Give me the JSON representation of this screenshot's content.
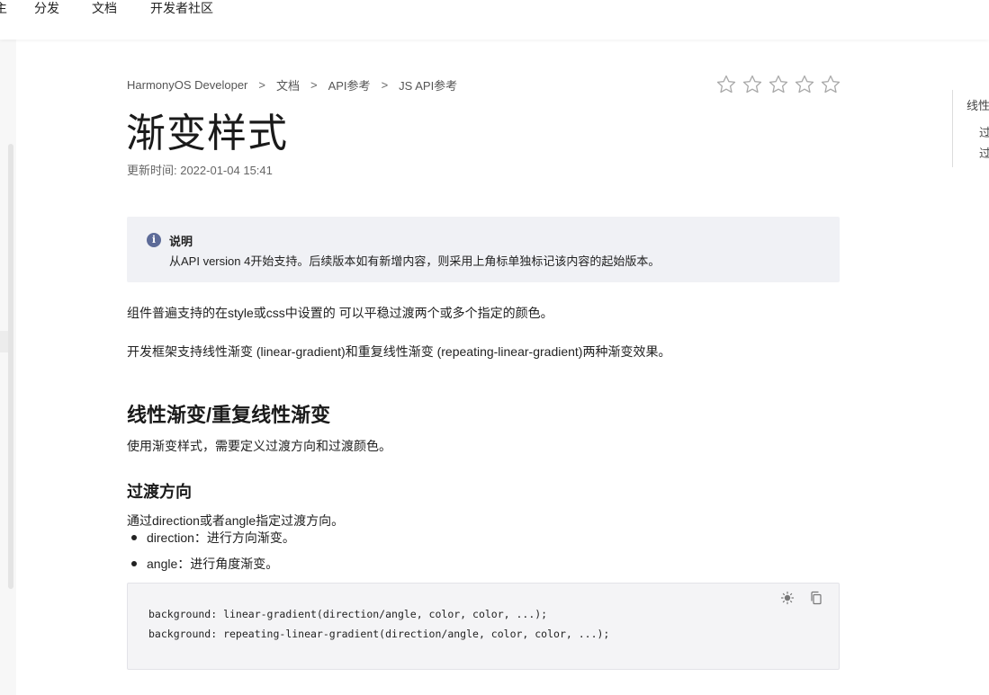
{
  "topnav": {
    "items": [
      {
        "label": "主"
      },
      {
        "label": "分发"
      },
      {
        "label": "文档"
      },
      {
        "label": "开发者社区"
      }
    ]
  },
  "breadcrumb": {
    "items": [
      "HarmonyOS Developer",
      "文档",
      "API参考",
      "JS API参考"
    ],
    "separator": ">"
  },
  "rating": {
    "stars": 5,
    "filled": 0
  },
  "page": {
    "title": "渐变样式",
    "update_time": "更新时间: 2022-01-04 15:41"
  },
  "note": {
    "icon": "info-icon",
    "title": "说明",
    "text": "从API version 4开始支持。后续版本如有新增内容，则采用上角标单独标记该内容的起始版本。"
  },
  "content": {
    "p1": "组件普遍支持的在style或css中设置的 可以平稳过渡两个或多个指定的颜色。",
    "p2": "开发框架支持线性渐变 (linear-gradient)和重复线性渐变 (repeating-linear-gradient)两种渐变效果。",
    "h2": "线性渐变/重复线性渐变",
    "p3": "使用渐变样式，需要定义过渡方向和过渡颜色。",
    "h3": "过渡方向",
    "p4": "通过direction或者angle指定过渡方向。",
    "bullets": [
      "direction：进行方向渐变。",
      "angle：进行角度渐变。"
    ]
  },
  "code": {
    "lines": [
      "background: linear-gradient(direction/angle, color, color, ...);",
      "background: repeating-linear-gradient(direction/angle, color, color, ...);"
    ],
    "tools": [
      "theme-toggle-icon",
      "copy-icon"
    ]
  },
  "toc": {
    "items": [
      "线性",
      "过",
      "过"
    ]
  }
}
